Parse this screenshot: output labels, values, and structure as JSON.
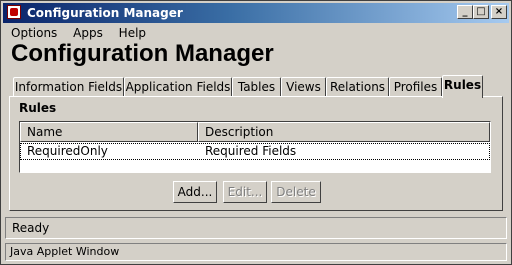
{
  "window": {
    "title": "Configuration Manager",
    "icon": "java-applet-icon",
    "controls": [
      "minimize",
      "maximize",
      "close"
    ]
  },
  "menu": [
    "Options",
    "Apps",
    "Help"
  ],
  "header": {
    "title": "Configuration Manager"
  },
  "tabs": [
    {
      "label": "Information Fields",
      "active": false
    },
    {
      "label": "Application Fields",
      "active": false
    },
    {
      "label": "Tables",
      "active": false
    },
    {
      "label": "Views",
      "active": false
    },
    {
      "label": "Relations",
      "active": false
    },
    {
      "label": "Profiles",
      "active": false
    },
    {
      "label": "Rules",
      "active": true
    }
  ],
  "panel": {
    "title": "Rules",
    "table": {
      "columns": [
        "Name",
        "Description"
      ],
      "rows": [
        {
          "name": "RequiredOnly",
          "description": "Required Fields"
        }
      ]
    },
    "buttons": {
      "add": "Add...",
      "edit": "Edit...",
      "delete": "Delete"
    }
  },
  "status": "Ready",
  "applet_notice": "Java Applet Window"
}
